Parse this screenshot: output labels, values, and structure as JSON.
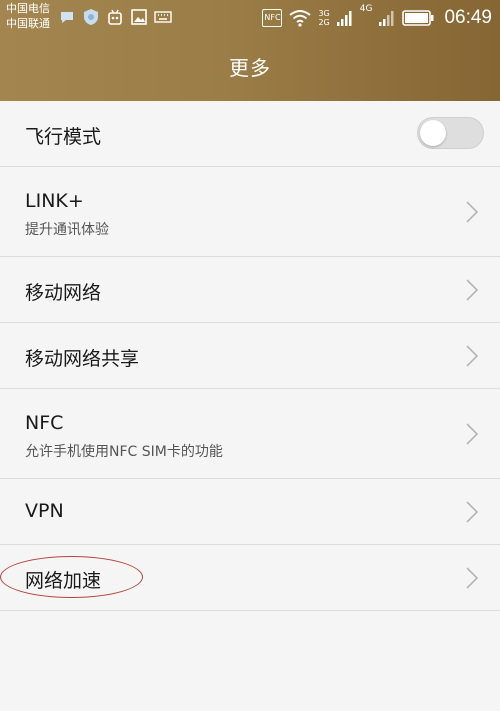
{
  "status_bar": {
    "carrier_1": "中国电信",
    "carrier_2": "中国联通",
    "nfc_label": "NFC",
    "net_3g": "3G",
    "net_2g": "2G",
    "net_4g": "4G",
    "time": "06:49",
    "icons_left": [
      "notification-icon",
      "shield-icon",
      "robot-icon",
      "image-icon",
      "keyboard-icon"
    ],
    "icons_right": [
      "nfc-icon",
      "wifi-icon",
      "signal-icon",
      "signal-icon",
      "battery-icon"
    ]
  },
  "header": {
    "title": "更多"
  },
  "items": [
    {
      "label": "飞行模式",
      "type": "toggle",
      "on": false
    },
    {
      "label": "LINK+",
      "sub": "提升通讯体验",
      "type": "nav"
    },
    {
      "label": "移动网络",
      "type": "nav"
    },
    {
      "label": "移动网络共享",
      "type": "nav"
    },
    {
      "label": "NFC",
      "sub": "允许手机使用NFC SIM卡的功能",
      "type": "nav"
    },
    {
      "label": "VPN",
      "type": "nav"
    },
    {
      "label": "网络加速",
      "type": "nav",
      "highlighted": true
    }
  ],
  "colors": {
    "header_bg": "#9b7d47",
    "annotation": "#b5443b",
    "background": "#f5f5f5"
  }
}
